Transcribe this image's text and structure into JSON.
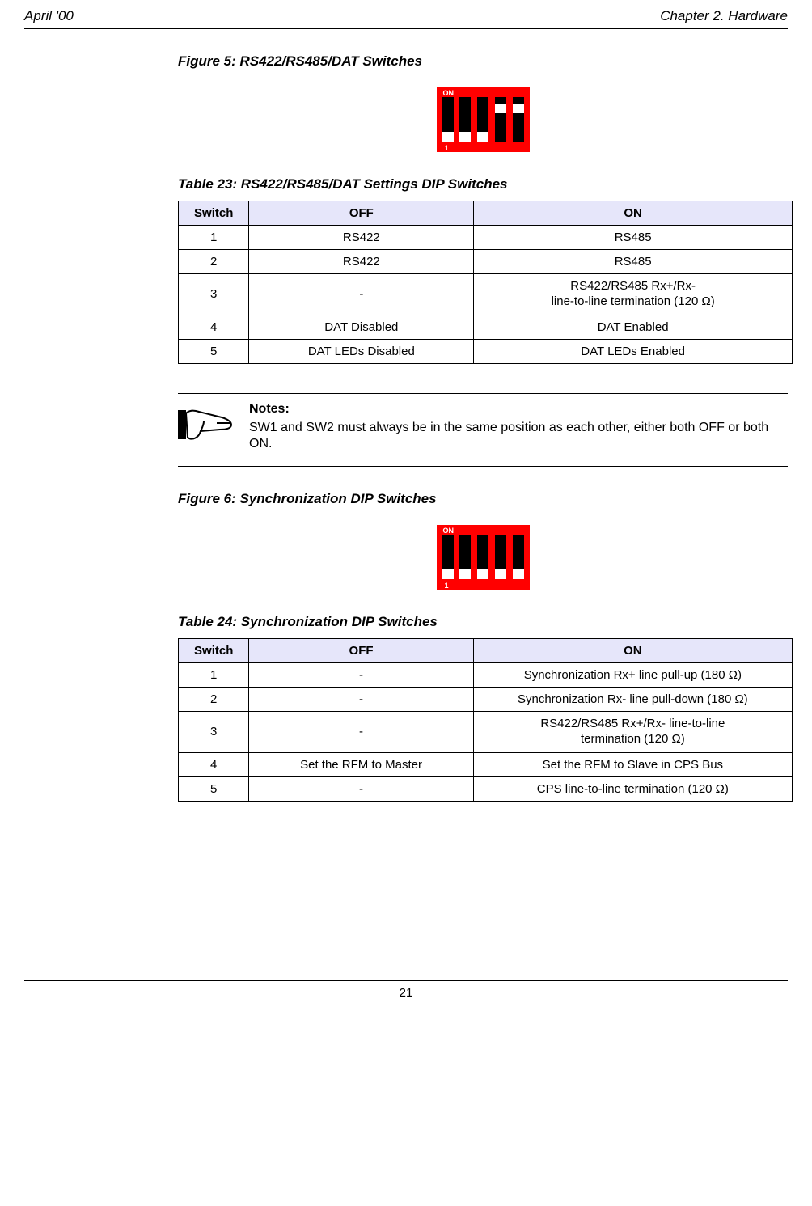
{
  "header": {
    "left": "April '00",
    "right": "Chapter 2. Hardware"
  },
  "figure5": {
    "title": "Figure 5: RS422/RS485/DAT Switches",
    "dip": {
      "on_label": "ON",
      "one_label": "1",
      "positions": [
        "bottom",
        "bottom",
        "bottom",
        "near-top",
        "near-top"
      ]
    }
  },
  "table23": {
    "title": "Table 23: RS422/RS485/DAT Settings DIP Switches",
    "columns": {
      "c0": "Switch",
      "c1": "OFF",
      "c2": "ON"
    },
    "rows": [
      {
        "sw": "1",
        "off": "RS422",
        "on": "RS485"
      },
      {
        "sw": "2",
        "off": "RS422",
        "on": "RS485"
      },
      {
        "sw": "3",
        "off": "-",
        "on_line1": "RS422/RS485 Rx+/Rx-",
        "on_line2": "line-to-line termination (120 Ω)"
      },
      {
        "sw": "4",
        "off": "DAT Disabled",
        "on": "DAT Enabled"
      },
      {
        "sw": "5",
        "off": "DAT LEDs Disabled",
        "on": "DAT LEDs Enabled"
      }
    ]
  },
  "notes": {
    "heading": "Notes:",
    "body": "SW1 and SW2 must always be in the same position as each other, either both OFF or both ON."
  },
  "figure6": {
    "title": "Figure 6: Synchronization DIP Switches",
    "dip": {
      "on_label": "ON",
      "one_label": "1",
      "positions": [
        "bottom",
        "bottom",
        "bottom",
        "bottom",
        "bottom"
      ]
    }
  },
  "table24": {
    "title": "Table 24: Synchronization DIP Switches",
    "columns": {
      "c0": "Switch",
      "c1": "OFF",
      "c2": "ON"
    },
    "rows": [
      {
        "sw": "1",
        "off": "-",
        "on": "Synchronization Rx+ line pull-up (180 Ω)"
      },
      {
        "sw": "2",
        "off": "-",
        "on": "Synchronization Rx- line pull-down (180 Ω)"
      },
      {
        "sw": "3",
        "off": "-",
        "on_line1": "RS422/RS485 Rx+/Rx- line-to-line",
        "on_line2": "termination (120 Ω)"
      },
      {
        "sw": "4",
        "off": "Set the RFM to Master",
        "on": "Set the RFM to Slave in CPS Bus"
      },
      {
        "sw": "5",
        "off": "-",
        "on": "CPS line-to-line termination (120 Ω)"
      }
    ]
  },
  "footer": {
    "page": "21"
  }
}
